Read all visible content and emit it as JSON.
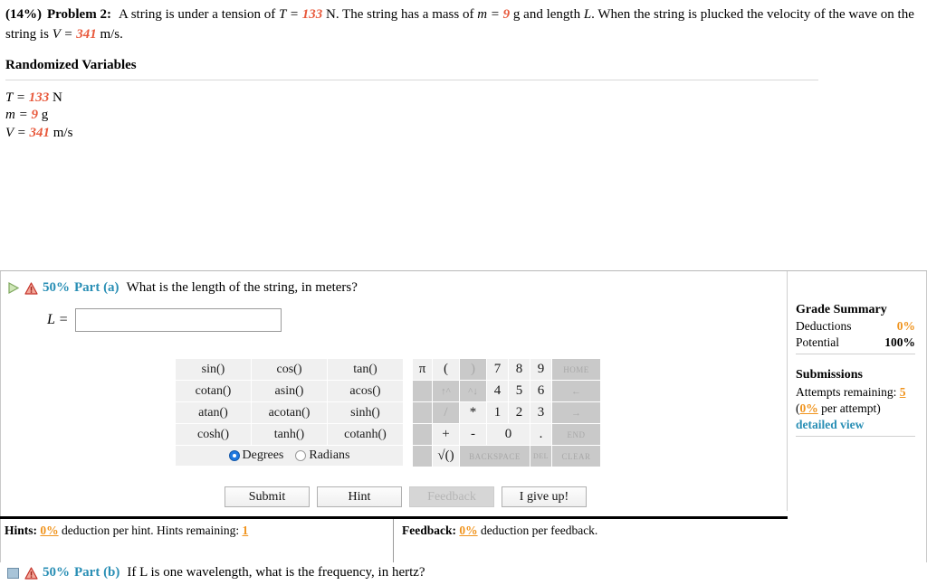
{
  "problem": {
    "percent": "(14%)",
    "number": "Problem 2:",
    "text_part1": "A string is under a tension of ",
    "var_T_sym": "T = ",
    "var_T_val": "133",
    "text_part2": " N. The string has a mass of ",
    "var_m_sym": "m = ",
    "var_m_val": "9",
    "text_part3": " g and length ",
    "var_L_sym": "L",
    "text_part4": ". When the string is plucked the velocity of the wave on the string is ",
    "var_V_sym": "V = ",
    "var_V_val": "341",
    "text_part5": " m/s."
  },
  "randomized": {
    "title": "Randomized Variables",
    "rows": [
      {
        "symbol": "T = ",
        "value": "133",
        "unit": " N"
      },
      {
        "symbol": "m = ",
        "value": "9",
        "unit": " g"
      },
      {
        "symbol": "V = ",
        "value": "341",
        "unit": " m/s"
      }
    ]
  },
  "part_a": {
    "expand_icon": "play-triangle-icon",
    "warn_icon": "warning-triangle-icon",
    "weight": "50%",
    "label": "Part (a)",
    "question": "What is the length of the string, in meters?",
    "answer_symbol": "L =",
    "answer_value": "",
    "answer_placeholder": ""
  },
  "part_b": {
    "collapse_icon": "collapsed-square-icon",
    "warn_icon": "warning-triangle-icon",
    "weight": "50%",
    "label": "Part (b)",
    "question": "If L is one wavelength, what is the frequency, in hertz?"
  },
  "calculator": {
    "functions": [
      [
        "sin()",
        "cos()",
        "tan()"
      ],
      [
        "cotan()",
        "asin()",
        "acos()"
      ],
      [
        "atan()",
        "acotan()",
        "sinh()"
      ],
      [
        "cosh()",
        "tanh()",
        "cotanh()"
      ]
    ],
    "mode_degrees": "Degrees",
    "mode_radians": "Radians",
    "mode_selected": "Degrees",
    "numpad": [
      [
        {
          "t": "π",
          "s": "on"
        },
        {
          "t": "(",
          "s": "on"
        },
        {
          "t": ")",
          "s": "dim"
        },
        {
          "t": "7",
          "s": "on"
        },
        {
          "t": "8",
          "s": "on"
        },
        {
          "t": "9",
          "s": "on"
        },
        {
          "t": "HOME",
          "s": "dim-small"
        }
      ],
      [
        {
          "t": "",
          "s": "blank"
        },
        {
          "t": "↑^",
          "s": "dim-arrow"
        },
        {
          "t": "^↓",
          "s": "dim-arrow"
        },
        {
          "t": "4",
          "s": "on"
        },
        {
          "t": "5",
          "s": "on"
        },
        {
          "t": "6",
          "s": "on"
        },
        {
          "t": "←",
          "s": "dim-arrow"
        }
      ],
      [
        {
          "t": "",
          "s": "blank"
        },
        {
          "t": "/",
          "s": "dim"
        },
        {
          "t": "*",
          "s": "on"
        },
        {
          "t": "1",
          "s": "on"
        },
        {
          "t": "2",
          "s": "on"
        },
        {
          "t": "3",
          "s": "on"
        },
        {
          "t": "→",
          "s": "dim-arrow"
        }
      ],
      [
        {
          "t": "",
          "s": "blank"
        },
        {
          "t": "+",
          "s": "on"
        },
        {
          "t": "-",
          "s": "on"
        },
        {
          "t": "0",
          "s": "on",
          "span": 2
        },
        {
          "t": ".",
          "s": "on"
        },
        {
          "t": "END",
          "s": "dim-small"
        }
      ],
      [
        {
          "t": "",
          "s": "blank"
        },
        {
          "t": "√()",
          "s": "on"
        },
        {
          "t": "BACKSPACE",
          "s": "dim-small",
          "span": 3
        },
        {
          "t": "DEL",
          "s": "dim-small"
        },
        {
          "t": "CLEAR",
          "s": "dim-small"
        }
      ]
    ]
  },
  "actions": {
    "submit": "Submit",
    "hint": "Hint",
    "feedback": "Feedback",
    "give_up": "I give up!"
  },
  "grade_summary": {
    "title": "Grade Summary",
    "deductions_label": "Deductions",
    "deductions_value": "0%",
    "potential_label": "Potential",
    "potential_value": "100%",
    "submissions_title": "Submissions",
    "attempts_label": "Attempts remaining:",
    "attempts_value": "5",
    "per_attempt_open": "(",
    "per_attempt_value": "0%",
    "per_attempt_text": " per attempt)",
    "detailed_view": "detailed view"
  },
  "footer": {
    "hints_label": "Hints:",
    "hints_value": "0%",
    "hints_text": "deduction per hint. Hints remaining:",
    "hints_remaining": "1",
    "feedback_label": "Feedback:",
    "feedback_value": "0%",
    "feedback_text": "deduction per feedback."
  },
  "colors": {
    "accent_teal": "#2a8fb5",
    "value_red": "#e8593c",
    "value_orange": "#f0941e",
    "radio_blue": "#1f78e0"
  }
}
